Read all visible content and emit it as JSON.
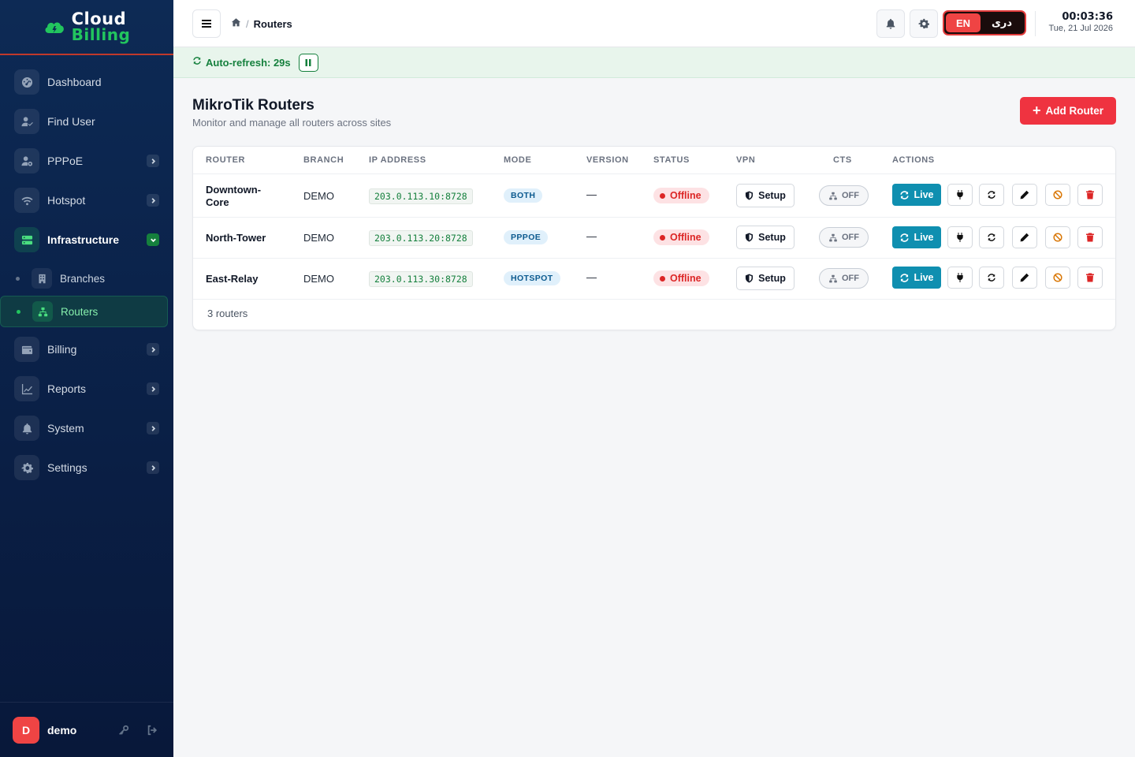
{
  "brand": {
    "line1": "Cloud",
    "line2": "Billing"
  },
  "sidebar": {
    "items": [
      {
        "label": "Dashboard",
        "icon": "dashboard-icon",
        "has_chevron": false
      },
      {
        "label": "Find User",
        "icon": "find-user-icon",
        "has_chevron": false
      },
      {
        "label": "PPPoE",
        "icon": "pppoe-user-icon",
        "has_chevron": true
      },
      {
        "label": "Hotspot",
        "icon": "wifi-icon",
        "has_chevron": true
      },
      {
        "label": "Infrastructure",
        "icon": "server-icon",
        "has_chevron": true,
        "expanded": true
      },
      {
        "label": "Billing",
        "icon": "wallet-icon",
        "has_chevron": true
      },
      {
        "label": "Reports",
        "icon": "chart-line-icon",
        "has_chevron": true
      },
      {
        "label": "System",
        "icon": "bell-icon",
        "has_chevron": true
      },
      {
        "label": "Settings",
        "icon": "gear-icon",
        "has_chevron": true
      }
    ],
    "sub_items": [
      {
        "label": "Branches",
        "icon": "building-icon",
        "active": false
      },
      {
        "label": "Routers",
        "icon": "network-icon",
        "active": true
      }
    ]
  },
  "user": {
    "initial": "D",
    "name": "demo"
  },
  "topbar": {
    "breadcrumb": "Routers",
    "lang_en": "EN",
    "lang_alt": "دری",
    "time": "00:03:36",
    "date": "Tue, 21 Jul 2026"
  },
  "refresh": {
    "text": "Auto-refresh: 29s"
  },
  "page": {
    "title": "MikroTik Routers",
    "subtitle": "Monitor and manage all routers across sites",
    "add_button": "Add Router"
  },
  "table": {
    "headers": [
      "ROUTER",
      "BRANCH",
      "IP ADDRESS",
      "MODE",
      "VERSION",
      "STATUS",
      "VPN",
      "CTS",
      "ACTIONS"
    ],
    "rows": [
      {
        "name_line1": "Downtown-",
        "name_line2": "Core",
        "branch": "DEMO",
        "ip": "203.0.113.10:8728",
        "mode": "BOTH",
        "version": "—",
        "status": "Offline",
        "vpn": "Setup",
        "cts": "OFF",
        "live": "Live"
      },
      {
        "name_line1": "North-Tower",
        "name_line2": "",
        "branch": "DEMO",
        "ip": "203.0.113.20:8728",
        "mode": "PPPOE",
        "version": "—",
        "status": "Offline",
        "vpn": "Setup",
        "cts": "OFF",
        "live": "Live"
      },
      {
        "name_line1": "East-Relay",
        "name_line2": "",
        "branch": "DEMO",
        "ip": "203.0.113.30:8728",
        "mode": "HOTSPOT",
        "version": "—",
        "status": "Offline",
        "vpn": "Setup",
        "cts": "OFF",
        "live": "Live"
      }
    ],
    "footer": "3 routers"
  },
  "colors": {
    "sidebar_bg": "#0d2a55",
    "accent_green": "#22c55e",
    "danger": "#ef3340",
    "live_blue": "#0f8fb0",
    "offline_red": "#dc2626"
  }
}
